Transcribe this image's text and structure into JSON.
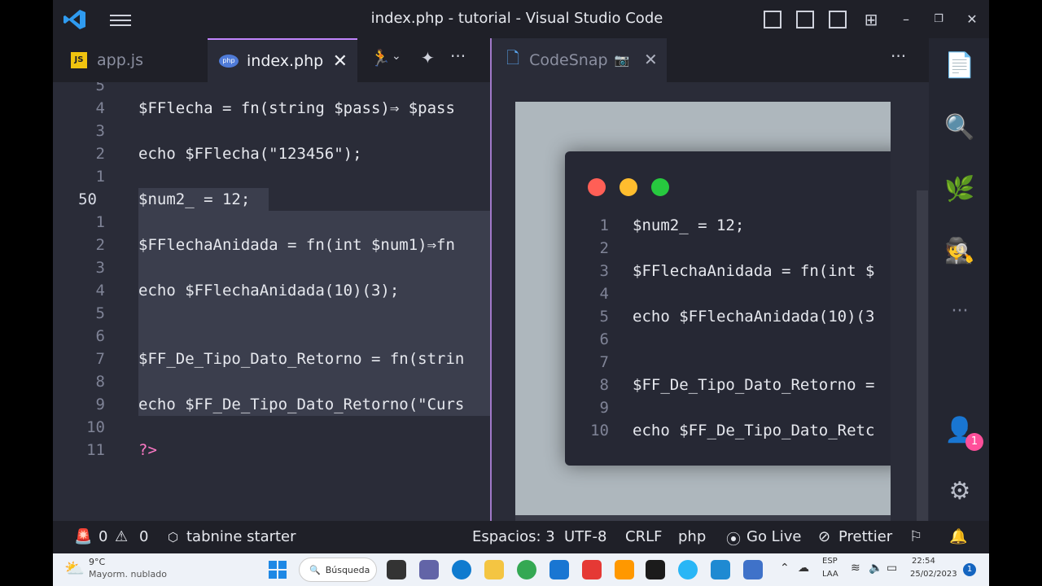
{
  "window": {
    "title": "index.php - tutorial - Visual Studio Code"
  },
  "tabs_left": [
    {
      "label": "app.js",
      "badge": "JS"
    },
    {
      "label": "index.php",
      "badge": "php",
      "close": "✕"
    }
  ],
  "tabs_right": {
    "label": "CodeSnap",
    "close": "✕",
    "more": "···"
  },
  "tabs_left_more": "···",
  "editor": {
    "lines": [
      {
        "num": "5"
      },
      {
        "num": "4",
        "code": "$FFlecha = fn(string $pass)⇒ $pass"
      },
      {
        "num": "3"
      },
      {
        "num": "2",
        "code": "echo $FFlecha(\"123456\");"
      },
      {
        "num": "1"
      },
      {
        "num": "50",
        "code": "$num2_ = 12;"
      },
      {
        "num": "1"
      },
      {
        "num": "2",
        "code": "$FFlechaAnidada = fn(int $num1)⇒fn"
      },
      {
        "num": "3"
      },
      {
        "num": "4",
        "code": "echo $FFlechaAnidada(10)(3);"
      },
      {
        "num": "5"
      },
      {
        "num": "6"
      },
      {
        "num": "7",
        "code": "$FF_De_Tipo_Dato_Retorno = fn(strin"
      },
      {
        "num": "8"
      },
      {
        "num": "9",
        "code": "echo $FF_De_Tipo_Dato_Retorno(\"Curs"
      },
      {
        "num": "10"
      },
      {
        "num": "11",
        "code": "?>"
      }
    ]
  },
  "codesnap": {
    "lines": [
      {
        "num": "1",
        "code": "$num2_ = 12;"
      },
      {
        "num": "2"
      },
      {
        "num": "3",
        "code": "$FFlechaAnidada = fn(int $"
      },
      {
        "num": "4"
      },
      {
        "num": "5",
        "code": "echo $FFlechaAnidada(10)(3"
      },
      {
        "num": "6"
      },
      {
        "num": "7"
      },
      {
        "num": "8",
        "code": "$FF_De_Tipo_Dato_Retorno ="
      },
      {
        "num": "9"
      },
      {
        "num": "10",
        "code": "echo $FF_De_Tipo_Dato_Retc"
      }
    ]
  },
  "activity_bar": {
    "accounts_badge": "1",
    "more": "···"
  },
  "statusbar": {
    "errors": "0",
    "warnings": "0",
    "tabnine": "tabnine starter",
    "spaces": "Espacios: 3",
    "encoding": "UTF-8",
    "eol": "CRLF",
    "language": "php",
    "golive": "Go Live",
    "prettier": "Prettier"
  },
  "taskbar": {
    "weather_temp": "9°C",
    "weather_desc": "Mayorm. nublado",
    "search": "Búsqueda",
    "lang1": "ESP",
    "lang2": "LAA",
    "time": "22:54",
    "date": "25/02/2023",
    "notif": "1"
  },
  "colors": {
    "accent": "#c084fc",
    "tab_bg": "#1f2028",
    "editor_bg": "#2a2c38"
  }
}
